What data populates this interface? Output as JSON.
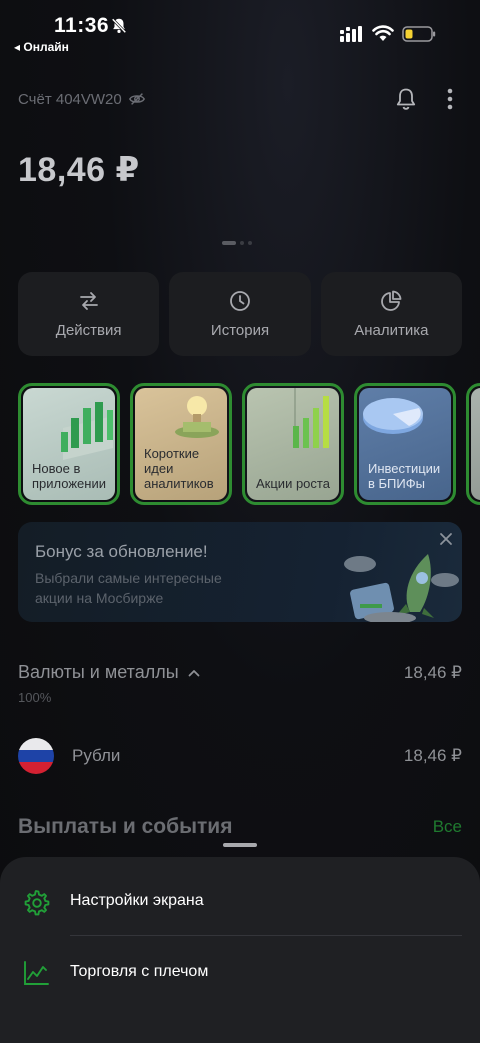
{
  "status_bar": {
    "time": "11:36",
    "back_label": "◂ Онлайн"
  },
  "header": {
    "account_label": "Счёт 404VW20",
    "balance": "18,46 ₽"
  },
  "actions": [
    {
      "label": "Действия",
      "icon": "arrows-swap-icon"
    },
    {
      "label": "История",
      "icon": "clock-icon"
    },
    {
      "label": "Аналитика",
      "icon": "pie-chart-icon"
    }
  ],
  "stories": [
    {
      "text": "Новое в приложении"
    },
    {
      "text": "Короткие идеи аналитиков"
    },
    {
      "text": "Акции роста"
    },
    {
      "text": "Инвестиции в БПИФы"
    },
    {
      "text": ""
    }
  ],
  "banner": {
    "title": "Бонус за обновление!",
    "subtitle": "Выбрали самые интересные акции на Мосбирже"
  },
  "currencies": {
    "title": "Валюты и металлы",
    "total": "18,46 ₽",
    "percent": "100%",
    "items": [
      {
        "name": "Рубли",
        "value": "18,46 ₽"
      }
    ]
  },
  "payouts": {
    "title": "Выплаты и события",
    "all_label": "Все"
  },
  "sheet": {
    "items": [
      {
        "label": "Настройки экрана",
        "icon": "gear-icon"
      },
      {
        "label": "Торговля с плечом",
        "icon": "chart-line-icon"
      }
    ]
  },
  "colors": {
    "accent_green": "#21a038",
    "background": "#0d0d0f",
    "card": "#1c1d20",
    "sheet": "#1f2023"
  }
}
